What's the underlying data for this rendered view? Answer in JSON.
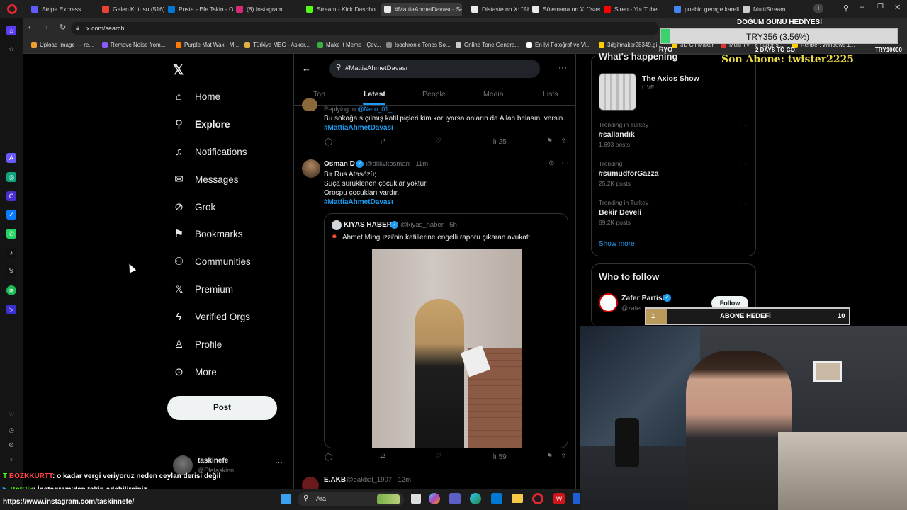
{
  "browser": {
    "tabs": [
      {
        "label": "Stripe Express",
        "color": "#635bff"
      },
      {
        "label": "Gelen Kutusu (516) -",
        "color": "#ea4335"
      },
      {
        "label": "Posta - Efe Tskin - Ou",
        "color": "#0078d4"
      },
      {
        "label": "(8) Instagram",
        "color": "#d62976"
      },
      {
        "label": "Stream - Kick Dashbo",
        "color": "#53fc18"
      },
      {
        "label": "#MattiaAhmetDavası - Se",
        "color": "#e7e9ea"
      },
      {
        "label": "Distaste on X: \"Ahme",
        "color": "#e7e9ea"
      },
      {
        "label": "Sülemana on X: \"isted",
        "color": "#e7e9ea"
      },
      {
        "label": "Siren - YouTube",
        "color": "#ff0000"
      },
      {
        "label": "pueblo george karelli",
        "color": "#4285f4"
      },
      {
        "label": "MultiStream",
        "color": "#cccccc"
      }
    ],
    "url": "x.com/search",
    "bookmarks": [
      {
        "label": "Upload Image — re...",
        "color": "#f0a030"
      },
      {
        "label": "Remove Noise from...",
        "color": "#8a5cff"
      },
      {
        "label": "Purple Mat Wax - M...",
        "color": "#ff7a00"
      },
      {
        "label": "Türkiye MEG - Asker...",
        "color": "#e0b040"
      },
      {
        "label": "Make it Meme - Çev...",
        "color": "#3cb043"
      },
      {
        "label": "Isochronic Tones So...",
        "color": "#888888"
      },
      {
        "label": "Online Tone Genera...",
        "color": "#cccccc"
      },
      {
        "label": "En İyi Fotoğraf ve Vi...",
        "color": "#ffffff"
      },
      {
        "label": "3dgifmaker28349.gi...",
        "color": "#ffcc00"
      },
      {
        "label": "3D Gif Maker",
        "color": "#ffcc00"
      },
      {
        "label": "Multi TV - 6 haber s...",
        "color": "#dd3333"
      },
      {
        "label": "Rehber: Windows 1...",
        "color": "#ffcc00"
      }
    ]
  },
  "nav": {
    "items": [
      {
        "label": "Home",
        "icon": "⌂"
      },
      {
        "label": "Explore",
        "icon": "⚲"
      },
      {
        "label": "Notifications",
        "icon": "♫"
      },
      {
        "label": "Messages",
        "icon": "✉"
      },
      {
        "label": "Grok",
        "icon": "⊘"
      },
      {
        "label": "Bookmarks",
        "icon": "⚑"
      },
      {
        "label": "Communities",
        "icon": "⚇"
      },
      {
        "label": "Premium",
        "icon": "𝕏"
      },
      {
        "label": "Verified Orgs",
        "icon": "ϟ"
      },
      {
        "label": "Profile",
        "icon": "♙"
      },
      {
        "label": "More",
        "icon": "⊙"
      }
    ],
    "post_label": "Post",
    "account_name": "taskinefe",
    "account_handle": "@Efetaskinn"
  },
  "search": {
    "query": "#MattiaAhmetDavası",
    "tabs": [
      "Top",
      "Latest",
      "People",
      "Media",
      "Lists"
    ],
    "active_tab": "Latest"
  },
  "tweets": [
    {
      "replying_prefix": "Replying to",
      "replying_to": "@Nero_01_",
      "text": "Bu sokağa sıçılmış katil piçleri kim koruyorsa onların da Allah belasını versin.",
      "hashtag": "#MattiaAhmetDavası",
      "views": "25"
    },
    {
      "name": "Osman D",
      "handle": "@dllkvkosman · 11m",
      "lines": [
        "Bir Rus Atasözü;",
        "Suça sürüklenen çocuklar yoktur.",
        "Orospu çocukları vardır."
      ],
      "hashtag": "#MattiaAhmetDavası",
      "quote_name": "KIYAS HABER",
      "quote_handle": "@kiyas_haber · 5h",
      "quote_text": "Ahmet Minguzzi'nin katillerine engelli raporu çıkaran avukat:",
      "views": "59"
    },
    {
      "name": "E.AKB",
      "handle": "@eakbal_1907 · 12m"
    }
  ],
  "trends": {
    "header": "What's happening",
    "featured_title": "The Axios Show",
    "featured_sub": "LIVE",
    "items": [
      {
        "category": "Trending in Turkey",
        "name": "#sallandık",
        "count": "1,693 posts"
      },
      {
        "category": "Trending",
        "name": "#sumudforGazza",
        "count": "25.2K posts"
      },
      {
        "category": "Trending in Turkey",
        "name": "Bekir Develi",
        "count": "89.2K posts"
      }
    ],
    "show_more": "Show more"
  },
  "who_to_follow": {
    "header": "Who to follow",
    "name": "Zafer Partisi",
    "handle": "@zafer",
    "follow_label": "Follow"
  },
  "stream": {
    "goal_title": "DOĞUM GÜNÜ HEDİYESİ",
    "goal_value": "TRY356 (3.56%)",
    "goal_left": "RYO",
    "goal_days": "2 DAYS TO GO",
    "goal_target": "TRY10000",
    "last_sub": "Son Abone: twister2225",
    "sub_goal_current": "1",
    "sub_goal_label": "ABONE HEDEFİ",
    "sub_goal_target": "10",
    "chat": [
      {
        "user": "BOZKKURTT",
        "text": ": o kadar vergi veriyoruz neden ceylan derisi değil"
      },
      {
        "user": "BotRix",
        "text": ": İnstagram'dan takip edebilirsiniz"
      }
    ],
    "chat_link": "https://www.instagram.com/taskinnefe/"
  },
  "taskbar": {
    "search_placeholder": "Ara"
  }
}
